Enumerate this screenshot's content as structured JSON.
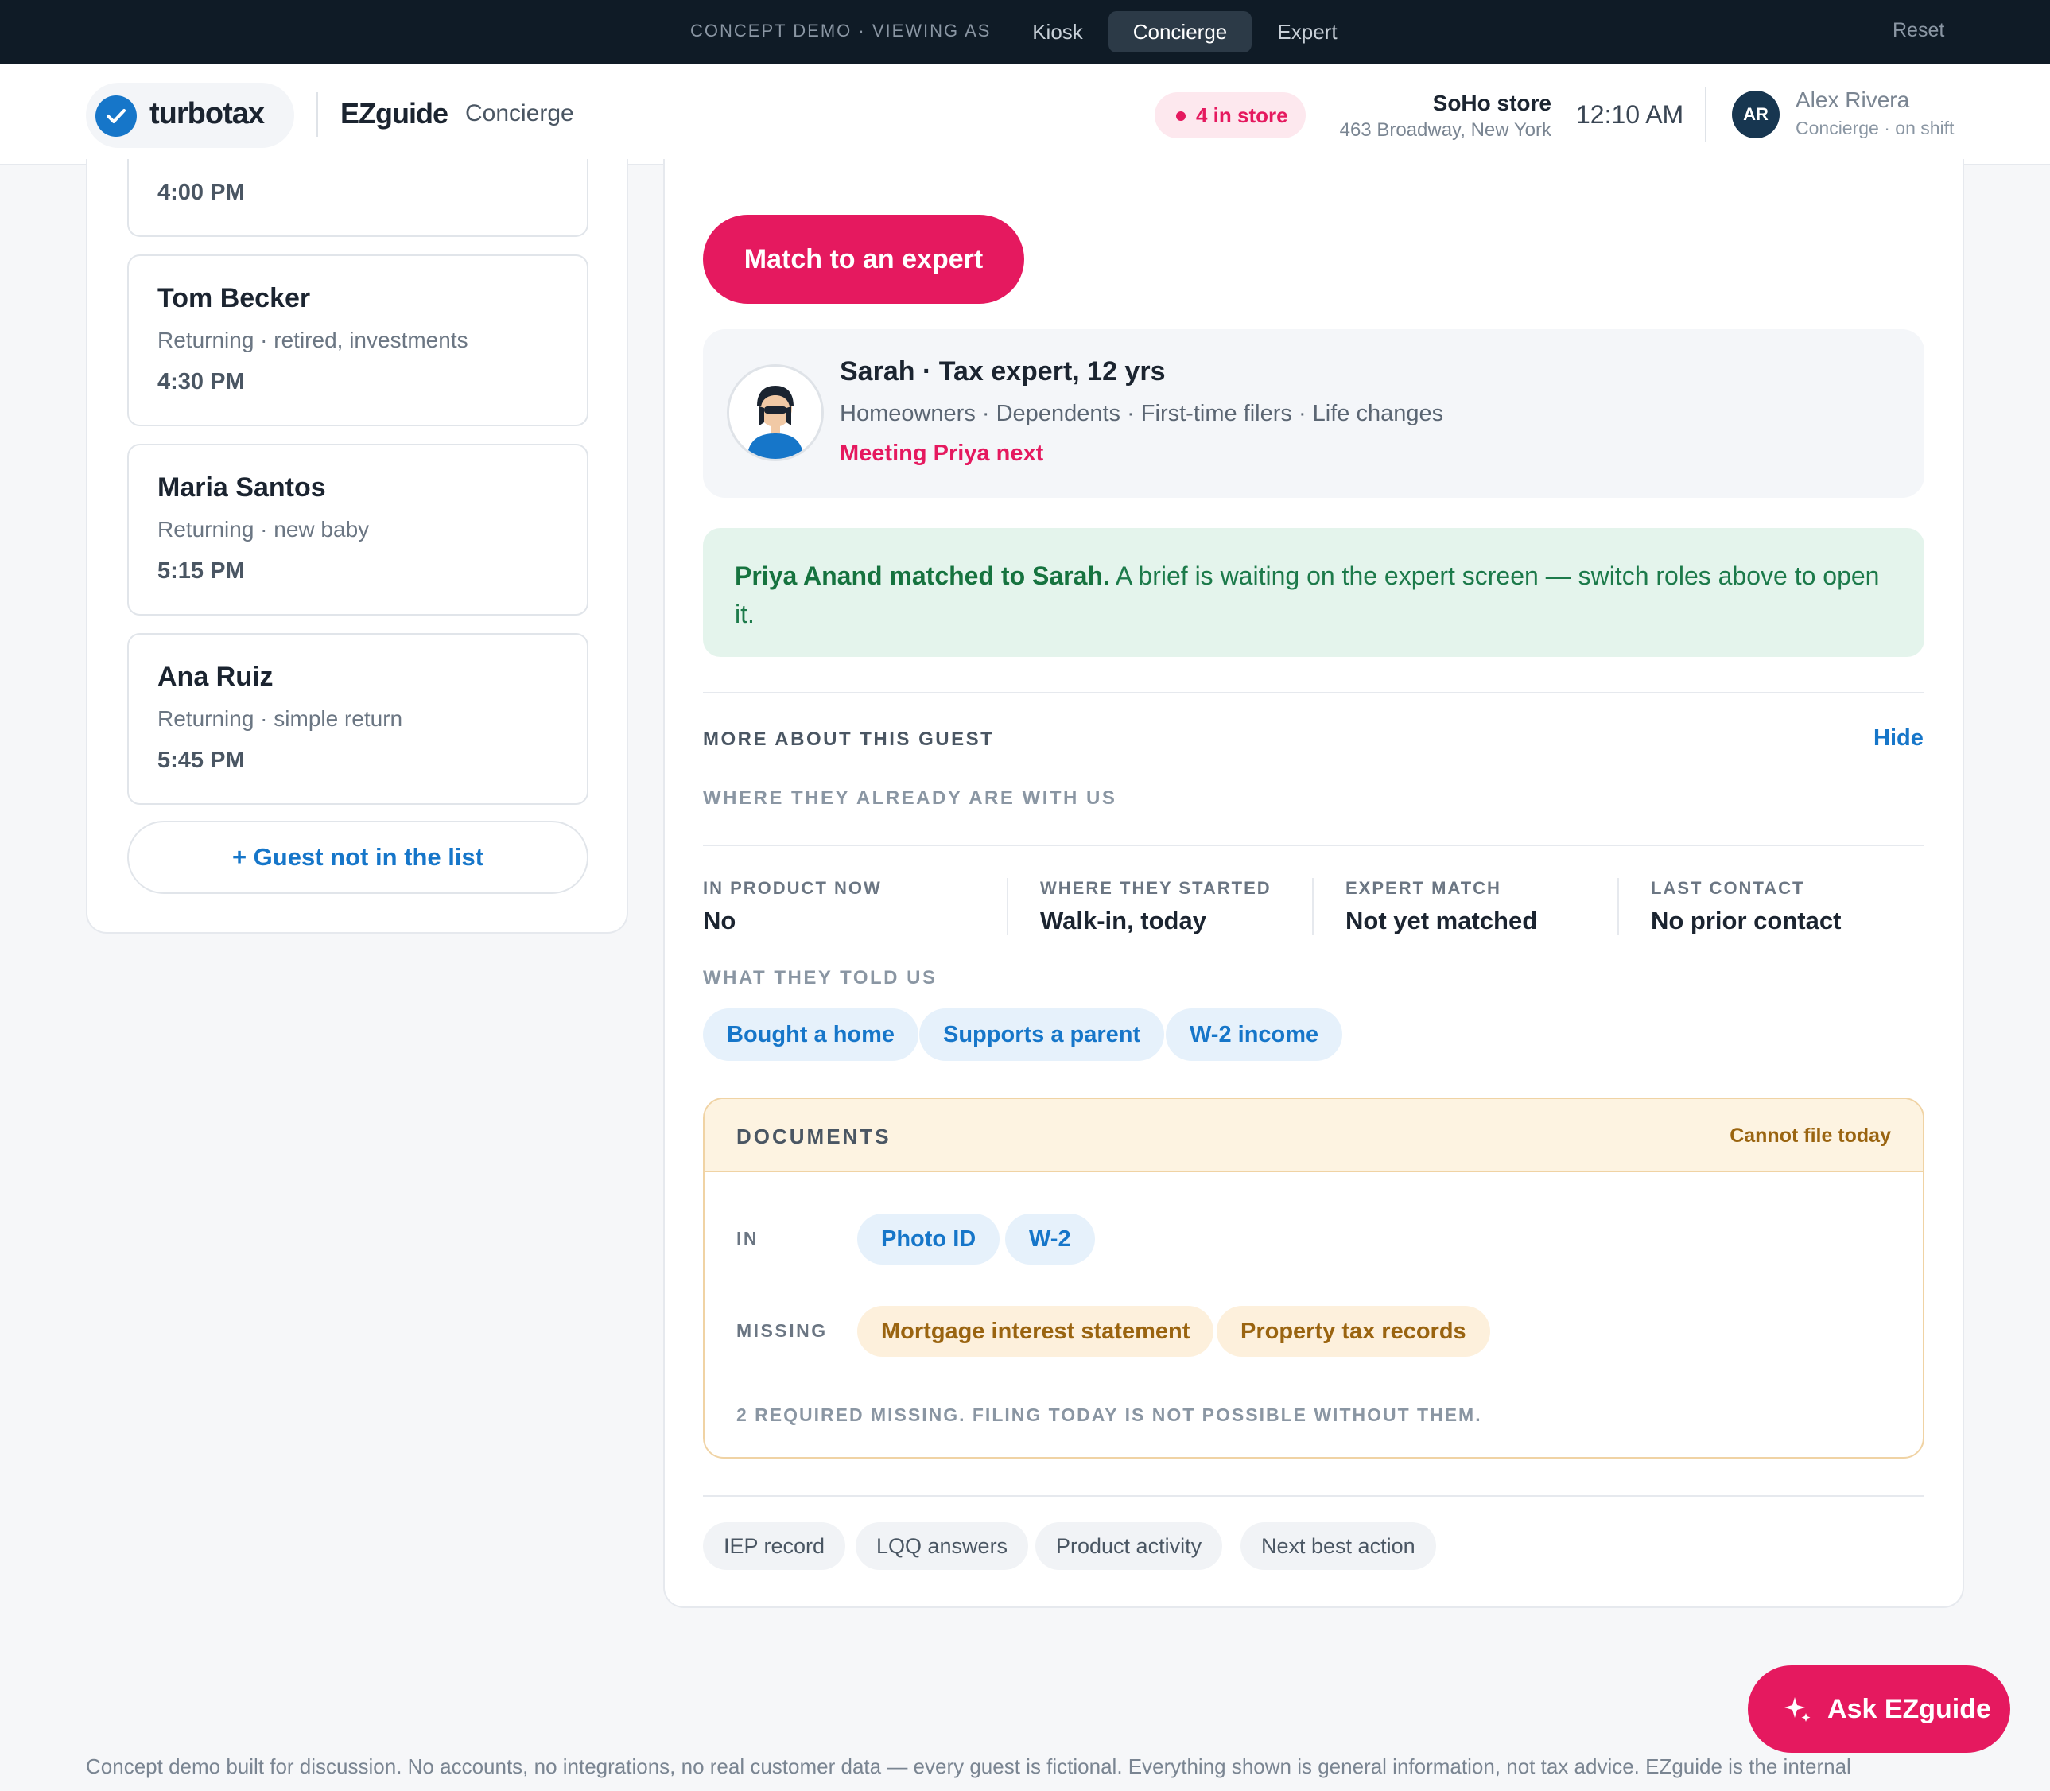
{
  "topbar": {
    "viewing_label": "CONCEPT DEMO · VIEWING AS",
    "roles": [
      "Kiosk",
      "Concierge",
      "Expert"
    ],
    "active_role": "Concierge",
    "reset_label": "Reset"
  },
  "header": {
    "brand": "turbotax",
    "product": "EZguide",
    "role": "Concierge",
    "in_store_badge": "4 in store",
    "store_name": "SoHo store",
    "store_address": "463 Broadway, New York",
    "time": "12:10 AM",
    "user_initials": "AR",
    "user_name": "Alex Rivera",
    "user_status": "Concierge · on shift"
  },
  "queue": {
    "partial_card_time": "4:00 PM",
    "guests": [
      {
        "name": "Tom Becker",
        "desc": "Returning · retired, investments",
        "time": "4:30 PM"
      },
      {
        "name": "Maria Santos",
        "desc": "Returning · new baby",
        "time": "5:15 PM"
      },
      {
        "name": "Ana Ruiz",
        "desc": "Returning · simple return",
        "time": "5:45 PM"
      }
    ],
    "add_guest_label": "+ Guest not in the list"
  },
  "main": {
    "match_button": "Match to an expert",
    "expert": {
      "title": "Sarah · Tax expert, 12 yrs",
      "specialties": "Homeowners · Dependents · First-time filers · Life changes",
      "next": "Meeting Priya next"
    },
    "notice": {
      "bold": "Priya Anand matched to Sarah.",
      "text": " A brief is waiting on the expert screen — switch roles above to open it."
    },
    "more_about": "MORE ABOUT THIS GUEST",
    "hide_label": "Hide",
    "where_label": "WHERE THEY ALREADY ARE WITH US",
    "stats": [
      {
        "key": "IN PRODUCT NOW",
        "value": "No"
      },
      {
        "key": "WHERE THEY STARTED",
        "value": "Walk-in, today"
      },
      {
        "key": "EXPERT MATCH",
        "value": "Not yet matched"
      },
      {
        "key": "LAST CONTACT",
        "value": "No prior contact"
      }
    ],
    "told_label": "WHAT THEY TOLD US",
    "told_chips": [
      "Bought a home",
      "Supports a parent",
      "W-2 income"
    ],
    "documents": {
      "title": "DOCUMENTS",
      "warning": "Cannot file today",
      "in_label": "IN",
      "in_items": [
        "Photo ID",
        "W-2"
      ],
      "missing_label": "MISSING",
      "missing_items": [
        "Mortgage interest statement",
        "Property tax records"
      ],
      "note": "2 REQUIRED MISSING. FILING TODAY IS NOT POSSIBLE WITHOUT THEM."
    },
    "tabs": [
      "IEP record",
      "LQQ answers",
      "Product activity",
      "Next best action"
    ]
  },
  "ask_button": "Ask EZguide",
  "footer": "Concept demo built for discussion. No accounts, no integrations, no real customer data — every guest is fictional. Everything shown is general information, not tax advice. EZguide is the internal",
  "colors": {
    "accent": "#e5195f",
    "brand_blue": "#1676c9",
    "success_bg": "#e4f4ec",
    "warning_bg": "#fdf3e1",
    "topbar_bg": "#0f1b26"
  },
  "icons": [
    "check-icon",
    "sparkle-icon",
    "expert-avatar"
  ]
}
